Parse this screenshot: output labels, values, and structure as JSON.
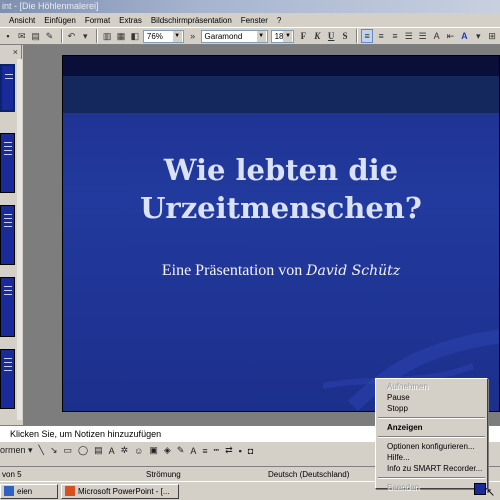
{
  "window": {
    "title": "int - [Die Höhlenmalerei]"
  },
  "menu": {
    "items": [
      "Ansicht",
      "Einfügen",
      "Format",
      "Extras",
      "Bildschirmpräsentation",
      "Fenster",
      "?"
    ]
  },
  "toolbar": {
    "zoom": "76%",
    "font": "Garamond",
    "size": "18",
    "bold": "F",
    "italic": "K",
    "underline": "U",
    "strike": "S"
  },
  "slide": {
    "title_line1": "Wie lebten die",
    "title_line2": "Urzeitmenschen?",
    "subtitle_prefix": "Eine Präsentation von",
    "subtitle_author": "David Schütz"
  },
  "thumbs_panel": {
    "close": "×"
  },
  "notes": {
    "placeholder": "Klicken Sie, um Notizen hinzuzufügen"
  },
  "drawbar": {
    "autoshapes": "ormen ▾"
  },
  "status": {
    "slide_of": "von 5",
    "design": "Strömung",
    "language": "Deutsch (Deutschland)"
  },
  "taskbar": {
    "start": "eien",
    "app": "Microsoft PowerPoint - [..."
  },
  "context_menu": {
    "items": [
      {
        "label": "Aufnehmen",
        "state": "disabled"
      },
      {
        "label": "Pause",
        "state": "normal"
      },
      {
        "label": "Stopp",
        "state": "normal"
      },
      {
        "label": "Anzeigen",
        "state": "bold"
      },
      {
        "label": "Optionen konfigurieren...",
        "state": "normal"
      },
      {
        "label": "Hilfe...",
        "state": "normal"
      },
      {
        "label": "Info zu SMART Recorder...",
        "state": "normal"
      },
      {
        "label": "Beenden",
        "state": "disabled"
      }
    ]
  }
}
